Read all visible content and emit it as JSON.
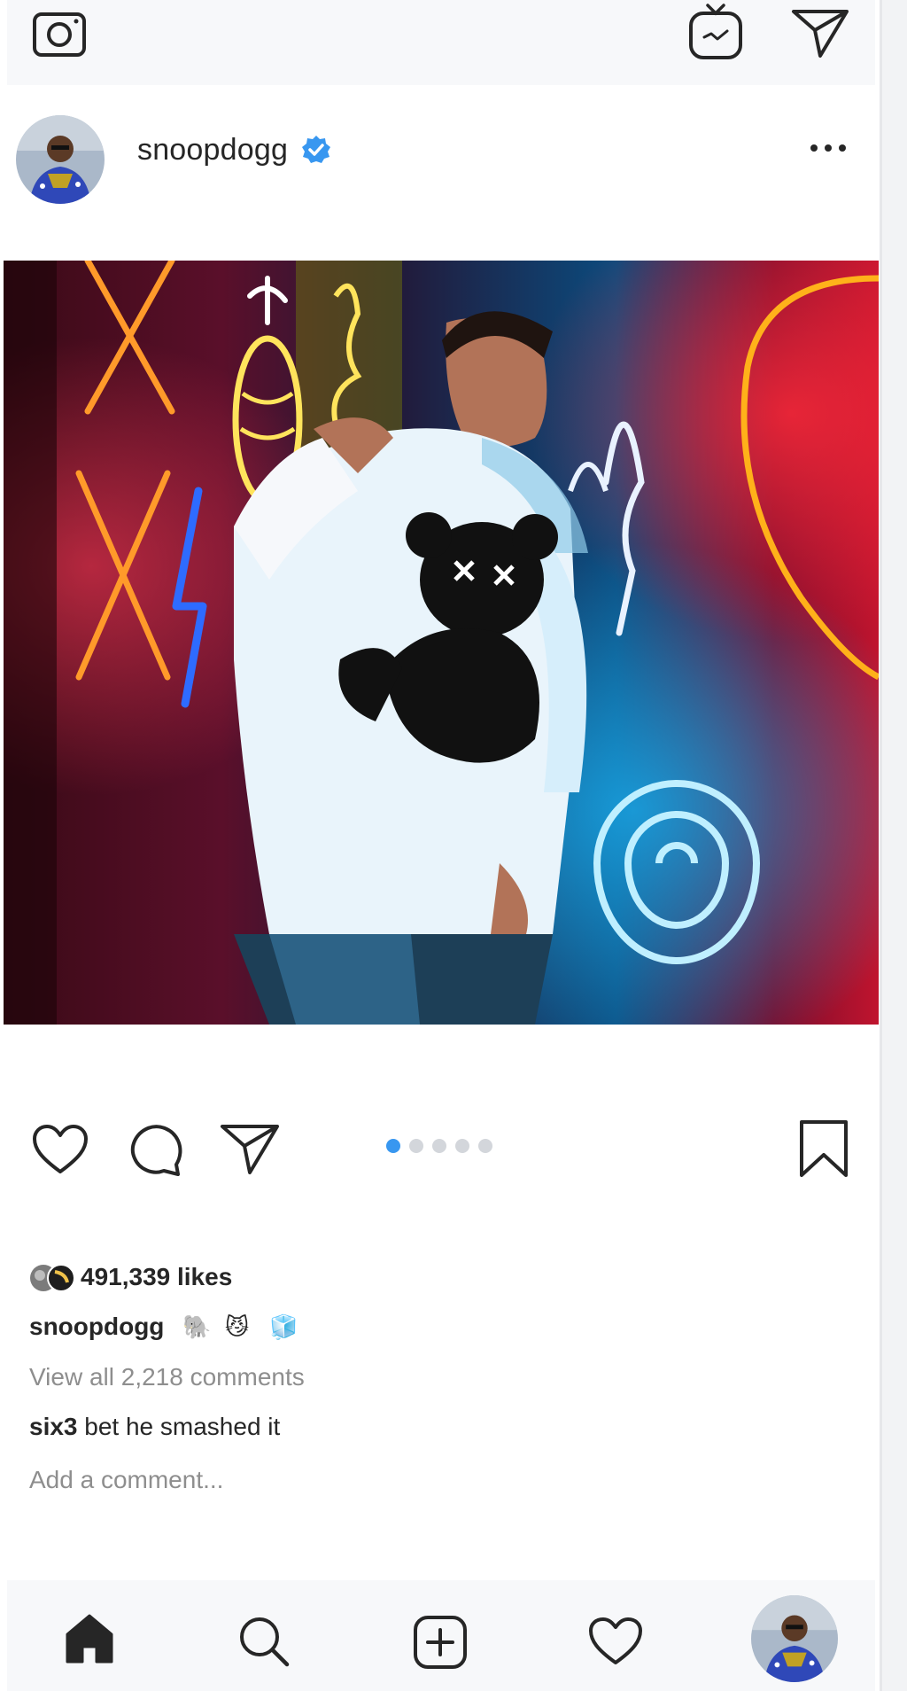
{
  "post": {
    "username": "snoopdogg",
    "likes_text": "491,339 likes",
    "caption_user": "snoopdogg",
    "caption_emojis": [
      "🐘",
      "😼",
      "🧊"
    ],
    "view_comments": "View all 2,218 comments",
    "comment": {
      "user": "six3",
      "text": "bet he smashed it"
    },
    "add_comment_placeholder": "Add a comment...",
    "carousel": {
      "total": 5,
      "active_index": 0
    }
  },
  "icons": {
    "top_left": "camera-icon",
    "top_right_1": "igtv-icon",
    "top_right_2": "direct-message-icon",
    "more": "more-options-icon",
    "actions": [
      "heart-icon",
      "comment-icon",
      "share-icon",
      "bookmark-icon"
    ],
    "nav": [
      "home-icon",
      "search-icon",
      "new-post-icon",
      "activity-icon",
      "profile-avatar"
    ]
  },
  "colors": {
    "accent": "#3897f0",
    "text": "#262626",
    "muted": "#8e8e8e",
    "bar_bg": "#f7f8fa"
  }
}
